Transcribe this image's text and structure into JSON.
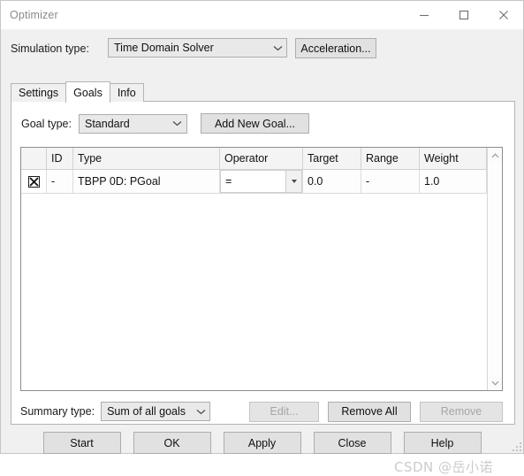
{
  "window": {
    "title": "Optimizer",
    "controls": {
      "minimize": "minimize-icon",
      "maximize": "maximize-icon",
      "close": "close-icon"
    }
  },
  "simulation": {
    "label": "Simulation type:",
    "combo_value": "Time Domain Solver",
    "acceleration_button": "Acceleration..."
  },
  "tabs": [
    {
      "label": "Settings",
      "active": false
    },
    {
      "label": "Goals",
      "active": true
    },
    {
      "label": "Info",
      "active": false
    }
  ],
  "goals_page": {
    "goal_type_label": "Goal type:",
    "goal_type_value": "Standard",
    "add_new_goal_button": "Add New Goal...",
    "grid": {
      "columns": [
        "",
        "ID",
        "Type",
        "Operator",
        "Target",
        "Range",
        "Weight"
      ],
      "rows": [
        {
          "checked": true,
          "id": "-",
          "type": "TBPP 0D: PGoal",
          "operator": "=",
          "target": "0.0",
          "range": "-",
          "weight": "1.0"
        }
      ]
    },
    "summary_label": "Summary type:",
    "summary_value": "Sum of all goals",
    "edit_button": "Edit...",
    "remove_all_button": "Remove All",
    "remove_button": "Remove"
  },
  "footer": {
    "buttons": [
      "Start",
      "OK",
      "Apply",
      "Close",
      "Help"
    ]
  },
  "watermark": "CSDN @岳小诺"
}
